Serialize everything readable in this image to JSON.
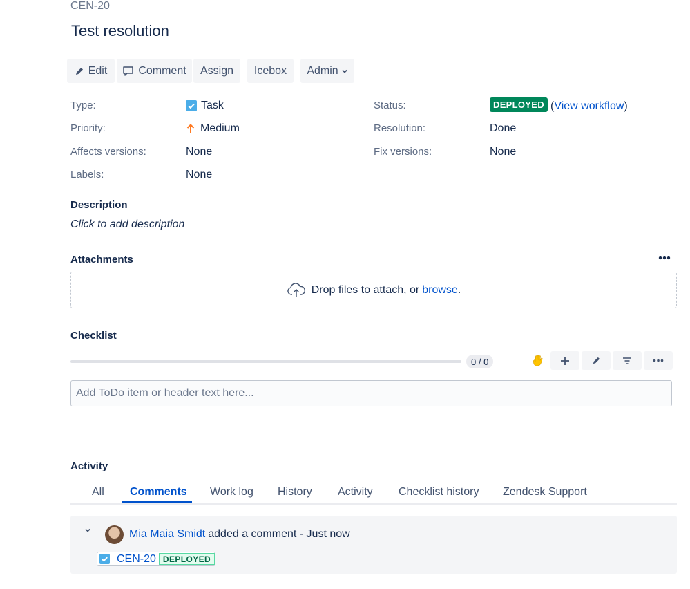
{
  "issue": {
    "key": "CEN-20",
    "title": "Test resolution"
  },
  "toolbar": {
    "edit_label": "Edit",
    "comment_label": "Comment",
    "assign_label": "Assign",
    "icebox_label": "Icebox",
    "admin_label": "Admin"
  },
  "details": {
    "type_label": "Type:",
    "type_value": "Task",
    "priority_label": "Priority:",
    "priority_value": "Medium",
    "affects_label": "Affects versions:",
    "affects_value": "None",
    "labels_label": "Labels:",
    "labels_value": "None",
    "status_label": "Status:",
    "status_value": "DEPLOYED",
    "view_workflow_open": "(",
    "view_workflow_link": "View workflow",
    "view_workflow_close": ")",
    "resolution_label": "Resolution:",
    "resolution_value": "Done",
    "fix_label": "Fix versions:",
    "fix_value": "None"
  },
  "description": {
    "title": "Description",
    "placeholder": "Click to add description"
  },
  "attachments": {
    "title": "Attachments",
    "drop_text": "Drop files to attach, or ",
    "browse_link": "browse",
    "drop_suffix": "."
  },
  "checklist": {
    "title": "Checklist",
    "progress": 0,
    "count": "0 / 0",
    "input_placeholder": "Add ToDo item or header text here..."
  },
  "activity": {
    "title": "Activity",
    "tabs": [
      {
        "label": "All",
        "active": false
      },
      {
        "label": "Comments",
        "active": true
      },
      {
        "label": "Work log",
        "active": false
      },
      {
        "label": "History",
        "active": false
      },
      {
        "label": "Activity",
        "active": false
      },
      {
        "label": "Checklist history",
        "active": false
      },
      {
        "label": "Zendesk Support",
        "active": false
      }
    ],
    "comment": {
      "author": "Mia Maia Smidt",
      "action": "added a comment - Just now",
      "issue_key": "CEN-20",
      "issue_status": "DEPLOYED"
    }
  },
  "colors": {
    "accent": "#0052cc",
    "deployed": "#00875a",
    "priority_medium": "#ff7a22",
    "task_blue": "#4bade8"
  }
}
